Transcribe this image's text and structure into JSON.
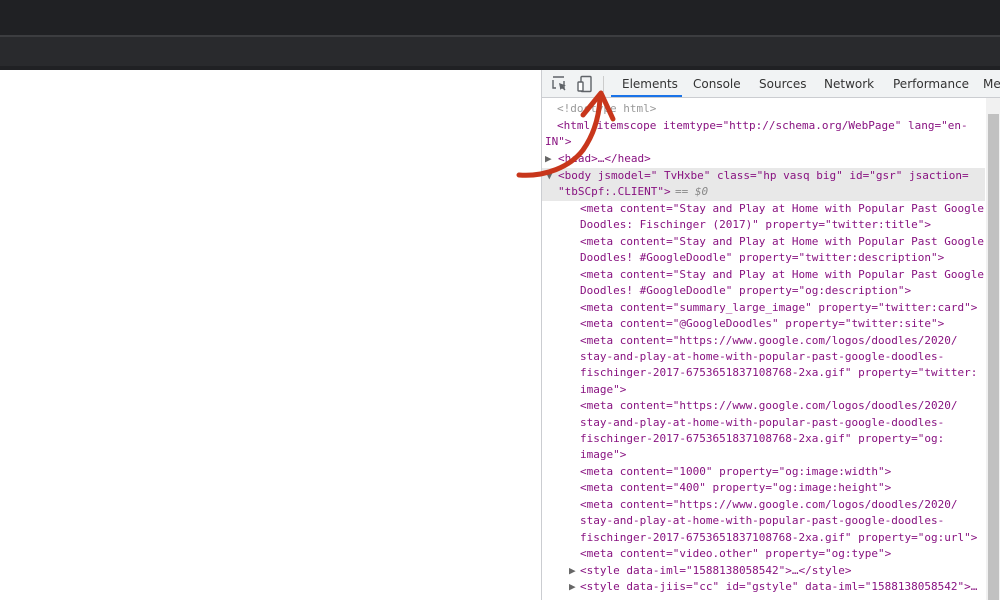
{
  "devtools": {
    "tabs": [
      "Elements",
      "Console",
      "Sources",
      "Network",
      "Performance",
      "Me"
    ],
    "active_tab": "Elements",
    "accent_color": "#1a73e8",
    "annotation_color": "#c8361b",
    "icons": [
      "inspect-element-icon",
      "device-toolbar-icon"
    ]
  },
  "dom": {
    "l1": "<!doctype html>",
    "l2a": "<html itemscope itemtype=\"http://schema.org/WebPage\" lang=\"en-",
    "l2b": "IN\">",
    "l3": "<head>…</head>",
    "l4a": "<body jsmodel=\" TvHxbe\" class=\"hp vasq big\" id=\"gsr\" jsaction=",
    "l4b": "\"tbSCpf:.CLIENT\">",
    "l4c": "== $0",
    "m1a": "<meta content=\"Stay and Play at Home with Popular Past Google",
    "m1b": "Doodles: Fischinger (2017)\" property=\"twitter:title\">",
    "m2a": "<meta content=\"Stay and Play at Home with Popular Past Google",
    "m2b": "Doodles! #GoogleDoodle\" property=\"twitter:description\">",
    "m3a": "<meta content=\"Stay and Play at Home with Popular Past Google",
    "m3b": "Doodles! #GoogleDoodle\" property=\"og:description\">",
    "m4": "<meta content=\"summary_large_image\" property=\"twitter:card\">",
    "m5": "<meta content=\"@GoogleDoodles\" property=\"twitter:site\">",
    "m6a": "<meta content=\"https://www.google.com/logos/doodles/2020/",
    "m6b": "stay-and-play-at-home-with-popular-past-google-doodles-",
    "m6c": "fischinger-2017-6753651837108768-2xa.gif\" property=\"twitter:",
    "m6d": "image\">",
    "m7a": "<meta content=\"https://www.google.com/logos/doodles/2020/",
    "m7b": "stay-and-play-at-home-with-popular-past-google-doodles-",
    "m7c": "fischinger-2017-6753651837108768-2xa.gif\" property=\"og:",
    "m7d": "image\">",
    "m8": "<meta content=\"1000\" property=\"og:image:width\">",
    "m9": "<meta content=\"400\" property=\"og:image:height\">",
    "m10a": "<meta content=\"https://www.google.com/logos/doodles/2020/",
    "m10b": "stay-and-play-at-home-with-popular-past-google-doodles-",
    "m10c": "fischinger-2017-6753651837108768-2xa.gif\" property=\"og:url\">",
    "m11": "<meta content=\"video.other\" property=\"og:type\">",
    "s1": "<style data-iml=\"1588138058542\">…</style>",
    "s2": "<style data-jiis=\"cc\" id=\"gstyle\" data-iml=\"1588138058542\">…"
  }
}
